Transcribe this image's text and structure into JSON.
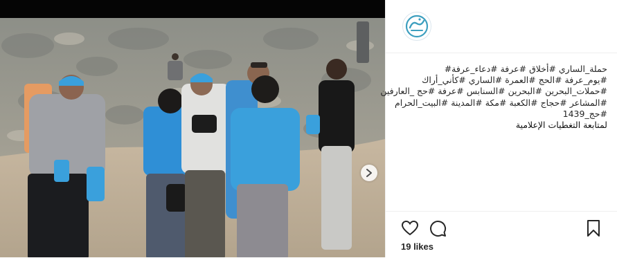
{
  "post": {
    "caption_lines": [
      "حملة_الساري #أخلاق #عرفة #دعاء_عرفة#",
      "#يوم_عرفة #الحج #العمرة #الساري #كأني_أراك",
      "#حملات_البحرين #البحرين #السنابس #عرفة #حج _العارفين",
      "#المشاعر #حجاج #الكعبة #مكة #المدينة #البيت_الحرام",
      "#حج_1439",
      "لمتابعة التغطيات الإعلامية"
    ],
    "likes": "19 likes"
  },
  "icons": {
    "like": "heart-icon",
    "comment": "comment-icon",
    "save": "bookmark-icon",
    "next": "chevron-right-icon",
    "avatar": "profile-logo"
  },
  "colors": {
    "accent_blue": "#3aa0dc",
    "logo_teal": "#3d9fbf"
  }
}
